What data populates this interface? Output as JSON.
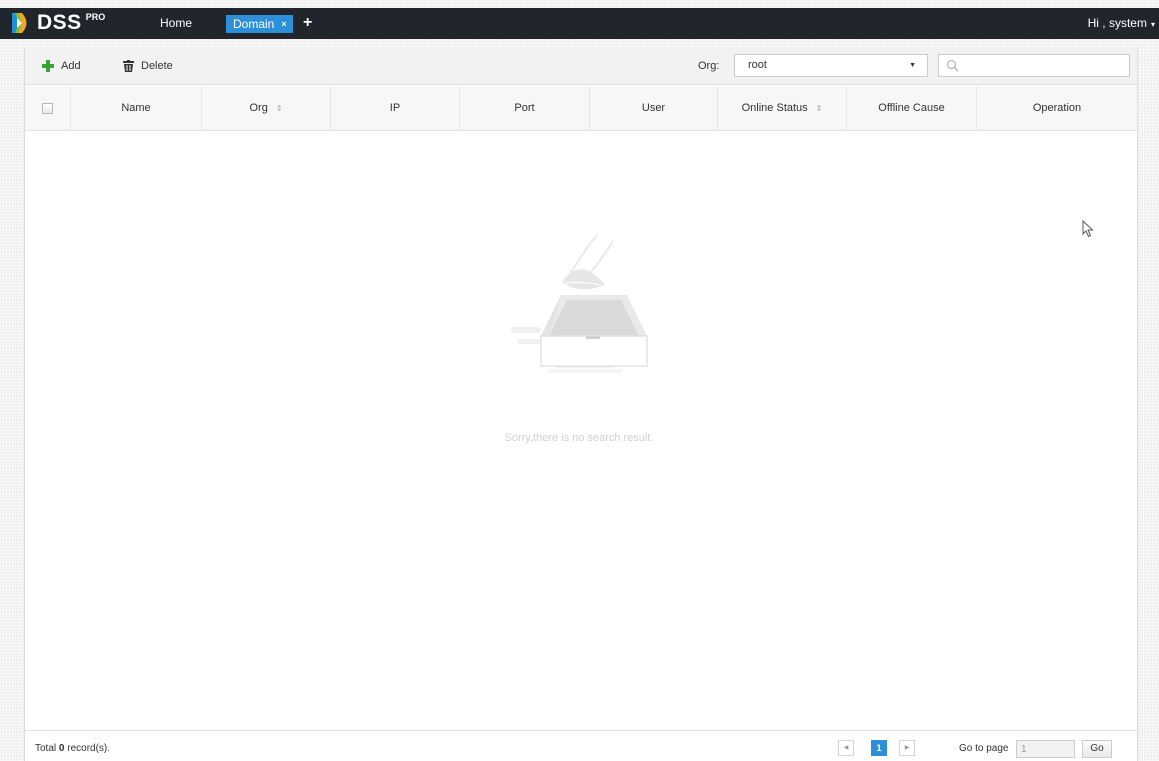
{
  "app": {
    "logo_text": "DSS",
    "logo_sup": "PRO"
  },
  "nav": {
    "home_label": "Home",
    "active_tab_label": "Domain",
    "tab_close_glyph": "×",
    "add_tab_glyph": "+",
    "user_label": "Hi , system",
    "user_caret": "▾"
  },
  "toolbar": {
    "add_label": "Add",
    "delete_label": "Delete",
    "org_label": "Org:",
    "org_value": "root",
    "search_value": "",
    "search_placeholder": ""
  },
  "table": {
    "columns": [
      {
        "label": "Name",
        "sortable": false
      },
      {
        "label": "Org",
        "sortable": true
      },
      {
        "label": "IP",
        "sortable": false
      },
      {
        "label": "Port",
        "sortable": false
      },
      {
        "label": "User",
        "sortable": false
      },
      {
        "label": "Online Status",
        "sortable": true
      },
      {
        "label": "Offline Cause",
        "sortable": false
      },
      {
        "label": "Operation",
        "sortable": false
      }
    ],
    "rows": [],
    "sort_glyph": "⇕",
    "empty_message": "Sorry,there is no search result."
  },
  "footer": {
    "total_prefix": "Total",
    "total_count": "0",
    "total_suffix": "record(s).",
    "prev_glyph": "◀",
    "next_glyph": "▶",
    "current_page": "1",
    "goto_label": "Go to page",
    "goto_value": "1",
    "go_label": "Go"
  },
  "colors": {
    "topbar_bg": "#21262c",
    "accent": "#2e8fd9",
    "add_icon": "#3aa335"
  },
  "icons": {
    "logo": "dss-logo-icon",
    "add": "plus-icon",
    "delete": "trash-icon",
    "search": "search-icon",
    "empty": "empty-box-icon",
    "cursor": "mouse-cursor-icon"
  }
}
